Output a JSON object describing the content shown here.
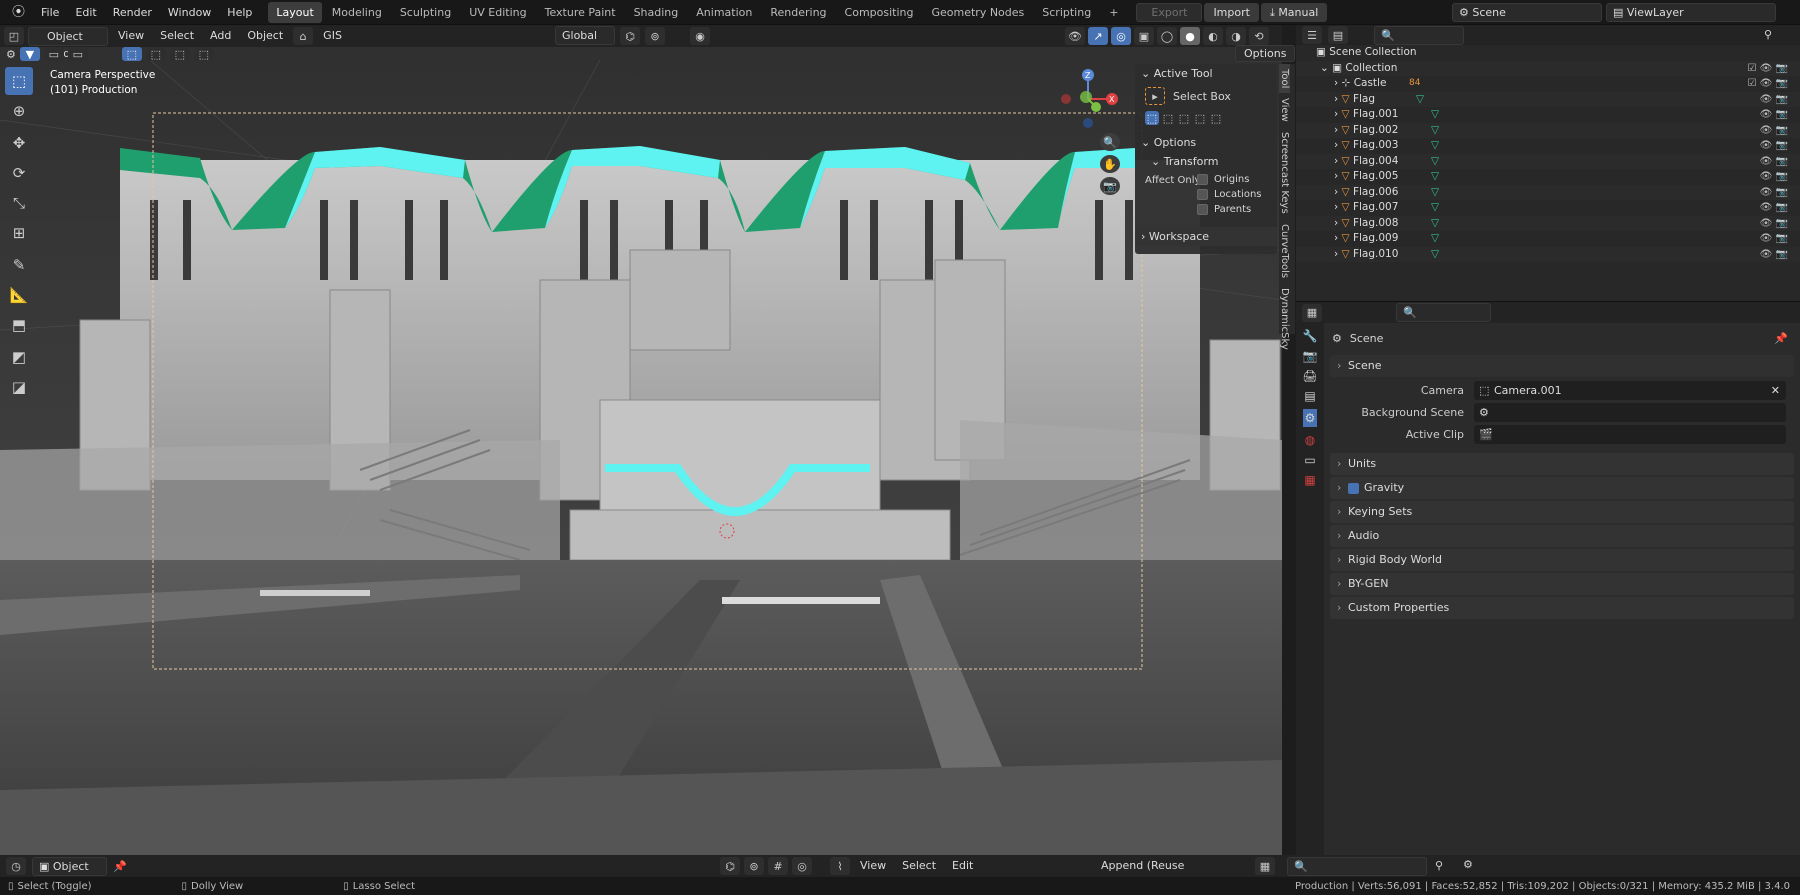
{
  "topbar": {
    "menus": [
      "File",
      "Edit",
      "Render",
      "Window",
      "Help"
    ],
    "workspaces": [
      "Layout",
      "Modeling",
      "Sculpting",
      "UV Editing",
      "Texture Paint",
      "Shading",
      "Animation",
      "Rendering",
      "Compositing",
      "Geometry Nodes",
      "Scripting"
    ],
    "active_workspace": "Layout",
    "add_tab": "+",
    "export": "Export",
    "import": "Import",
    "manual": "Manual",
    "scene": "Scene",
    "view_layer": "ViewLayer"
  },
  "vp_header": {
    "mode": "Object Mode",
    "menus": [
      "View",
      "Select",
      "Add",
      "Object"
    ],
    "gis": "GIS",
    "orientation": "Global",
    "options": "Options"
  },
  "viewport": {
    "view_name": "Camera Perspective",
    "collection_info": "(101) Production"
  },
  "npanel": {
    "active_tool_title": "Active Tool",
    "tool_name": "Select Box",
    "options_title": "Options",
    "transform_title": "Transform",
    "affect_only": "Affect Only",
    "origins": "Origins",
    "locations": "Locations",
    "parents": "Parents",
    "workspace_title": "Workspace",
    "tabs": [
      "Tool",
      "View",
      "Screencast Keys",
      "CurveTools",
      "DynamicSky"
    ]
  },
  "outliner": {
    "root": "Scene Collection",
    "collection": "Collection",
    "items": [
      "Castle",
      "Flag",
      "Flag.001",
      "Flag.002",
      "Flag.003",
      "Flag.004",
      "Flag.005",
      "Flag.006",
      "Flag.007",
      "Flag.008",
      "Flag.009",
      "Flag.010"
    ],
    "castle_badge": "84"
  },
  "properties": {
    "scene_title": "Scene",
    "scene_panel": "Scene",
    "camera_label": "Camera",
    "camera_value": "Camera.001",
    "background_label": "Background Scene",
    "clip_label": "Active Clip",
    "panels": [
      "Units",
      "Gravity",
      "Keying Sets",
      "Audio",
      "Rigid Body World",
      "BY-GEN",
      "Custom Properties"
    ]
  },
  "footer": {
    "object_mode": "Object",
    "menus": [
      "View",
      "Select",
      "Edit"
    ],
    "append": "Append (Reuse Data)"
  },
  "status": {
    "select": "Select (Toggle)",
    "dolly": "Dolly View",
    "lasso": "Lasso Select",
    "stats": "Production | Verts:56,091 | Faces:52,852 | Tris:109,202 | Objects:0/321 | Memory: 435.2 MiB | 3.4.0"
  },
  "colors": {
    "accent_blue": "#4772b3",
    "viewport_bg": "#3a3a3a",
    "cyan_highlight": "#5ef2f0",
    "green_roof": "#1f9e6e",
    "object_orange": "#e8953a",
    "mesh_green": "#33c08a"
  }
}
